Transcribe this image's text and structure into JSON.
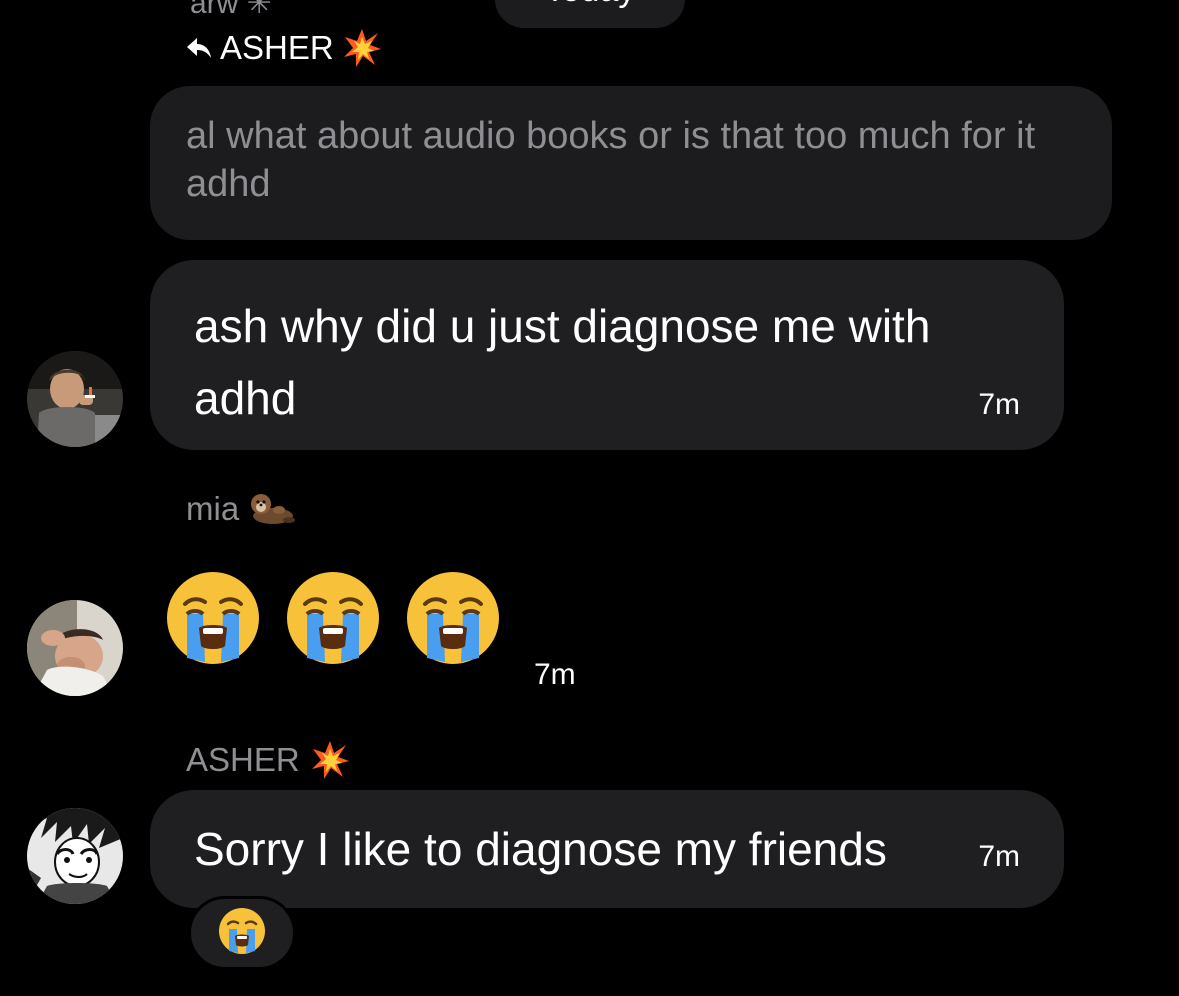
{
  "header": {
    "prev_sender_fragment": "arw ✳",
    "date_label": "Today"
  },
  "reply": {
    "to_label": "ASHER",
    "quoted_text": "al what about audio books or is that too much for it adhd"
  },
  "messages": [
    {
      "sender": "",
      "text": "ash why did u just diagnose me with adhd",
      "time": "7m",
      "avatar": "avatar-photo-man-lighting-cigarette"
    },
    {
      "sender": "mia",
      "sender_emoji": "otter-emoji",
      "emojis": [
        "loudly-crying-face-emoji",
        "loudly-crying-face-emoji",
        "loudly-crying-face-emoji"
      ],
      "time": "7m",
      "avatar": "avatar-photo-man-covering-face"
    },
    {
      "sender": "ASHER",
      "sender_emoji": "collision-emoji",
      "text": "Sorry I like to diagnose my friends",
      "time": "7m",
      "avatar": "avatar-manga-character",
      "reaction": "loudly-crying-face-emoji"
    }
  ],
  "colors": {
    "background": "#000000",
    "bubble": "#1f1f22",
    "quoted_bubble": "#1c1c1e",
    "muted_text": "#8e8e93",
    "text": "#ffffff"
  }
}
